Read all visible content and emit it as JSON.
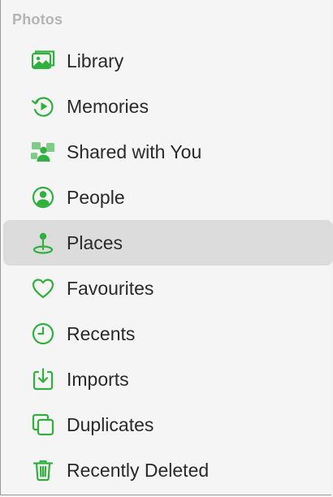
{
  "sidebar": {
    "section_title": "Photos",
    "accent_color": "#32b03f",
    "items": [
      {
        "label": "Library",
        "icon": "library-icon",
        "selected": false
      },
      {
        "label": "Memories",
        "icon": "memories-icon",
        "selected": false
      },
      {
        "label": "Shared with You",
        "icon": "shared-with-you-icon",
        "selected": false
      },
      {
        "label": "People",
        "icon": "people-icon",
        "selected": false
      },
      {
        "label": "Places",
        "icon": "places-icon",
        "selected": true
      },
      {
        "label": "Favourites",
        "icon": "heart-icon",
        "selected": false
      },
      {
        "label": "Recents",
        "icon": "clock-icon",
        "selected": false
      },
      {
        "label": "Imports",
        "icon": "import-icon",
        "selected": false
      },
      {
        "label": "Duplicates",
        "icon": "duplicates-icon",
        "selected": false
      },
      {
        "label": "Recently Deleted",
        "icon": "trash-icon",
        "selected": false
      }
    ]
  }
}
